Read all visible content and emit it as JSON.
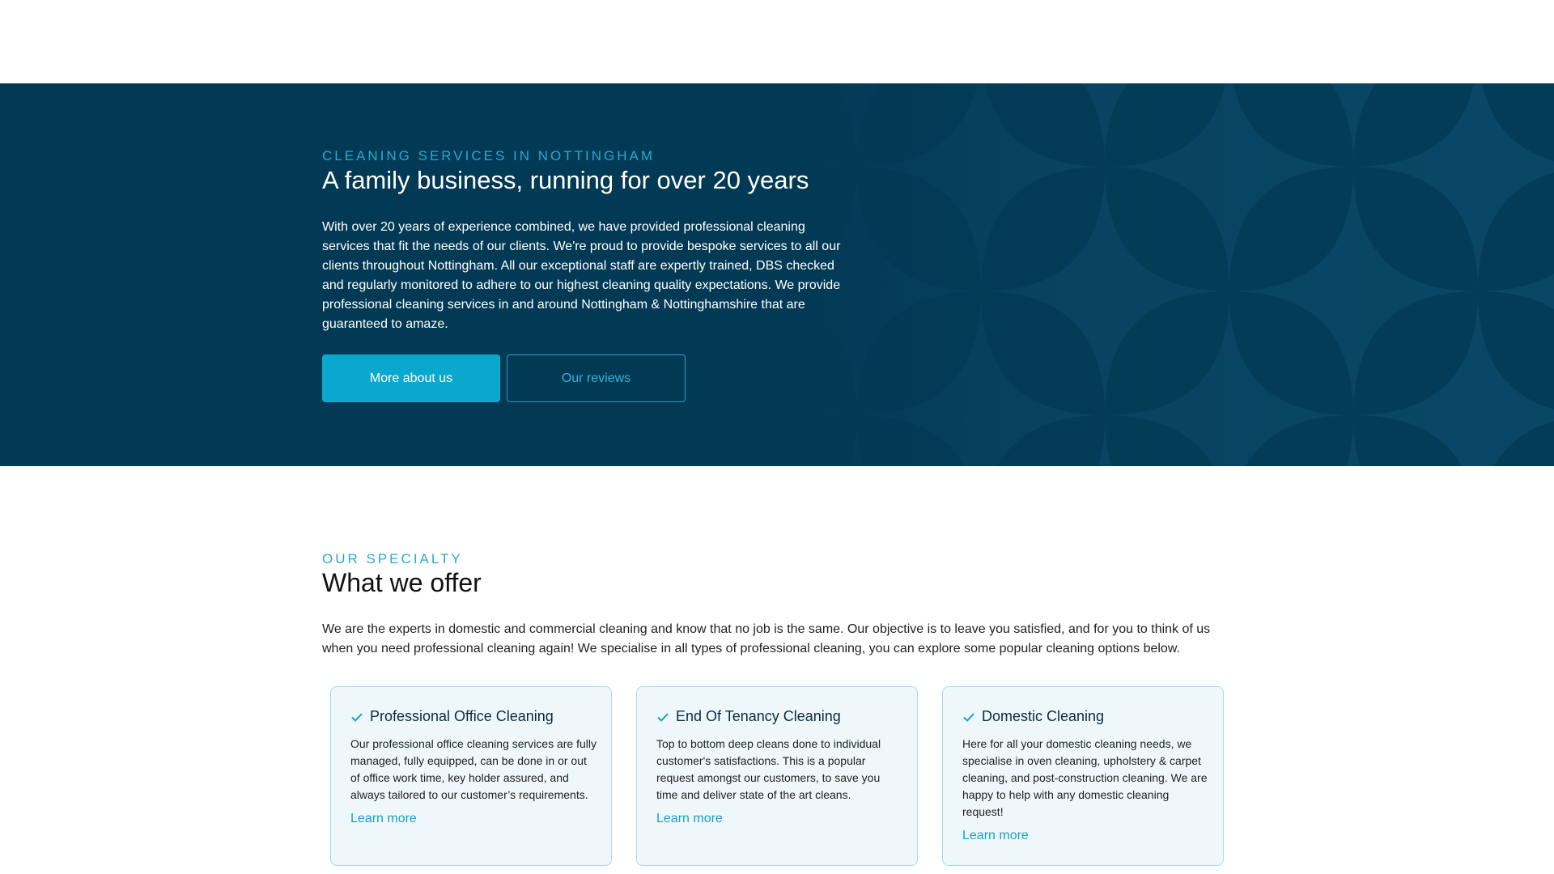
{
  "hero": {
    "eyebrow": "CLEANING SERVICES IN NOTTINGHAM",
    "title": "A family business, running for over 20 years",
    "text": "With over 20 years of experience combined, we have provided professional cleaning services that fit the needs of our clients. We're proud to provide bespoke services to all our clients throughout Nottingham. All our exceptional staff are expertly trained, DBS checked and regularly monitored to adhere to our highest cleaning quality expectations. We provide professional cleaning services in and around Nottingham & Nottinghamshire that are guaranteed to amaze.",
    "primary_button": "More about us",
    "secondary_button": "Our reviews"
  },
  "offer": {
    "eyebrow": "OUR SPECIALTY",
    "title": "What we offer",
    "text": "We are the experts in domestic and commercial cleaning and know that no job is the same. Our objective is to leave you satisfied, and for you to think of us when you need professional cleaning again! We specialise in all types of professional cleaning, you can explore some popular cleaning options below.",
    "cards": [
      {
        "title": "Professional Office Cleaning",
        "text": "Our professional office cleaning services are fully managed, fully equipped, can be done in or out of office work time, key holder assured, and always tailored to our customer’s requirements.",
        "link": "Learn more"
      },
      {
        "title": "End Of Tenancy Cleaning",
        "text": "Top to bottom deep cleans done to individual customer's satisfactions. This is a popular request amongst our customers, to save you time and deliver state of the art cleans.",
        "link": "Learn more"
      },
      {
        "title": "Domestic Cleaning",
        "text": "Here for all your domestic cleaning needs, we specialise in oven cleaning, upholstery & carpet cleaning, and post-construction cleaning. We are happy to help with any domestic cleaning request!",
        "link": "Learn more"
      }
    ]
  },
  "colors": {
    "hero_bg": "#023a55",
    "accent": "#0aa8cc",
    "eyebrow": "#29a9cf",
    "card_bg": "#eef8fb",
    "card_border": "#a8dce8"
  },
  "icons": [
    "check-icon",
    "petal-pattern"
  ]
}
